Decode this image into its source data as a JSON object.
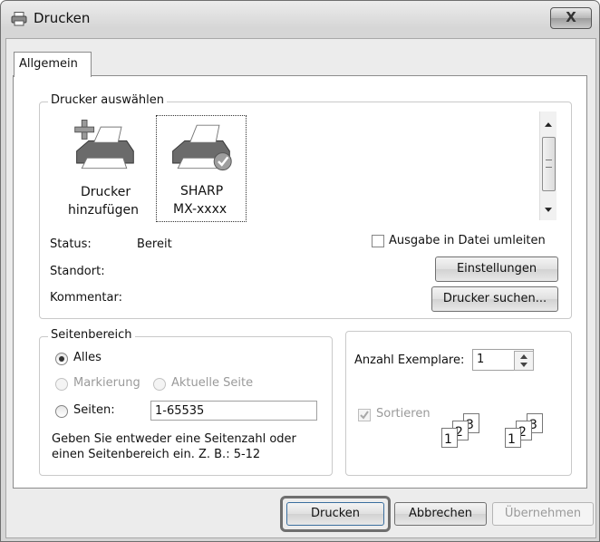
{
  "window": {
    "title": "Drucken",
    "close_label": "X"
  },
  "tabs": [
    {
      "label": "Allgemein"
    }
  ],
  "printer_select": {
    "group_label": "Drucker auswählen",
    "printers": [
      {
        "line1": "Drucker",
        "line2": "hinzufügen"
      },
      {
        "line1": "SHARP",
        "line2": "MX-xxxx"
      }
    ],
    "status_label": "Status:",
    "status_value": "Bereit",
    "location_label": "Standort:",
    "comment_label": "Kommentar:",
    "print_to_file_label": "Ausgabe in Datei umleiten",
    "settings_button": "Einstellungen",
    "find_printer_button": "Drucker suchen..."
  },
  "page_range": {
    "group_label": "Seitenbereich",
    "all_label": "Alles",
    "selection_label": "Markierung",
    "current_page_label": "Aktuelle Seite",
    "pages_label": "Seiten:",
    "pages_value": "1-65535",
    "hint": "Geben Sie entweder eine Seitenzahl oder einen Seitenbereich ein. Z. B.: 5-12"
  },
  "copies": {
    "label": "Anzahl Exemplare:",
    "value": "1",
    "collate_label": "Sortieren",
    "collate_checked": true,
    "page_numbers": [
      "1",
      "2",
      "3"
    ]
  },
  "buttons": {
    "print": "Drucken",
    "cancel": "Abbrechen",
    "apply": "Übernehmen"
  }
}
